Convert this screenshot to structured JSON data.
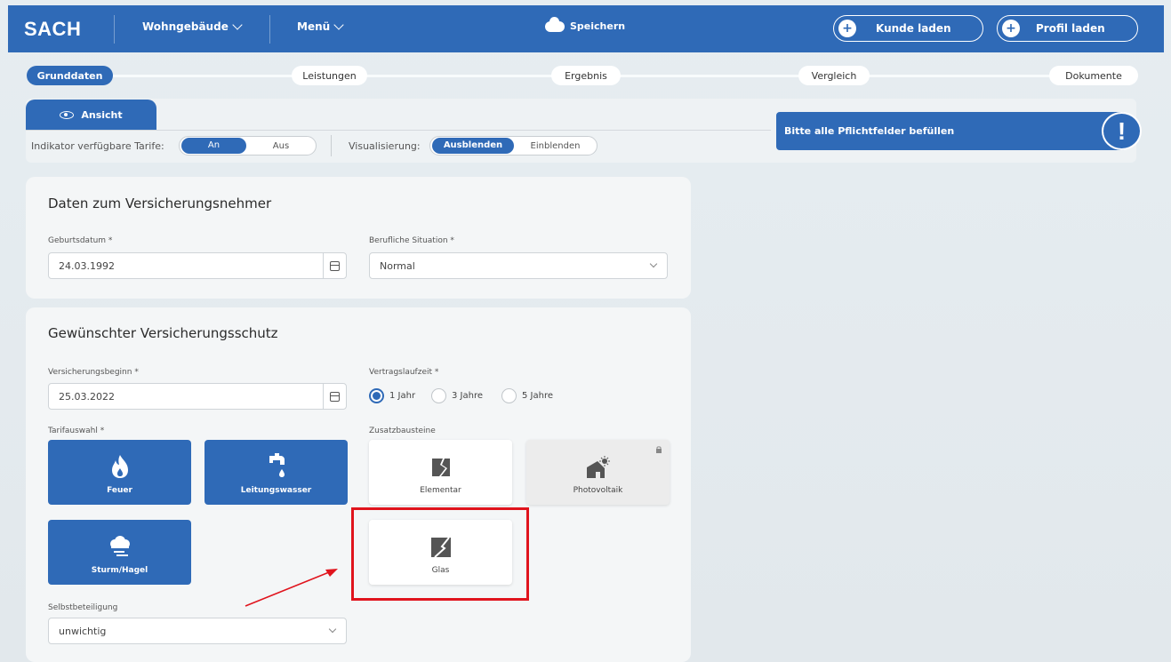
{
  "header": {
    "brand": "SACH",
    "nav_type": "Wohngebäude",
    "nav_menu": "Menü",
    "save_label": "Speichern",
    "load_customer": "Kunde laden",
    "load_profile": "Profil laden",
    "plus_symbol": "+"
  },
  "stepper": {
    "steps": [
      "Grunddaten",
      "Leistungen",
      "Ergebnis",
      "Vergleich",
      "Dokumente"
    ],
    "active_index": 0
  },
  "indicator": {
    "tab_label": "Ansicht",
    "tariffs_label": "Indikator verfügbare Tarife:",
    "tariffs_options": [
      "An",
      "Aus"
    ],
    "tariffs_selected": "An",
    "visual_label": "Visualisierung:",
    "visual_options": [
      "Ausblenden",
      "Einblenden"
    ],
    "visual_selected": "Ausblenden",
    "warning_text": "Bitte alle Pflichtfelder befüllen",
    "warning_symbol": "!"
  },
  "policyholder": {
    "title": "Daten zum Versicherungsnehmer",
    "birthdate_label": "Geburtsdatum *",
    "birthdate_value": "24.03.1992",
    "job_label": "Berufliche Situation *",
    "job_value": "Normal"
  },
  "coverage": {
    "title": "Gewünschter Versicherungsschutz",
    "start_label": "Versicherungsbeginn *",
    "start_value": "25.03.2022",
    "term_label": "Vertragslaufzeit *",
    "term_options": [
      "1 Jahr",
      "3 Jahre",
      "5 Jahre"
    ],
    "term_selected": "1 Jahr",
    "tariff_label": "Tarifauswahl *",
    "tariffs": [
      "Feuer",
      "Leitungswasser",
      "Sturm/Hagel"
    ],
    "addons_label": "Zusatzbausteine",
    "addons": [
      "Elementar",
      "Photovoltaik",
      "Glas"
    ],
    "deductible_label": "Selbstbeteiligung",
    "deductible_value": "unwichtig"
  },
  "colors": {
    "primary": "#2f6ab7",
    "highlight": "#e0141d",
    "background": "#e6edf1"
  }
}
